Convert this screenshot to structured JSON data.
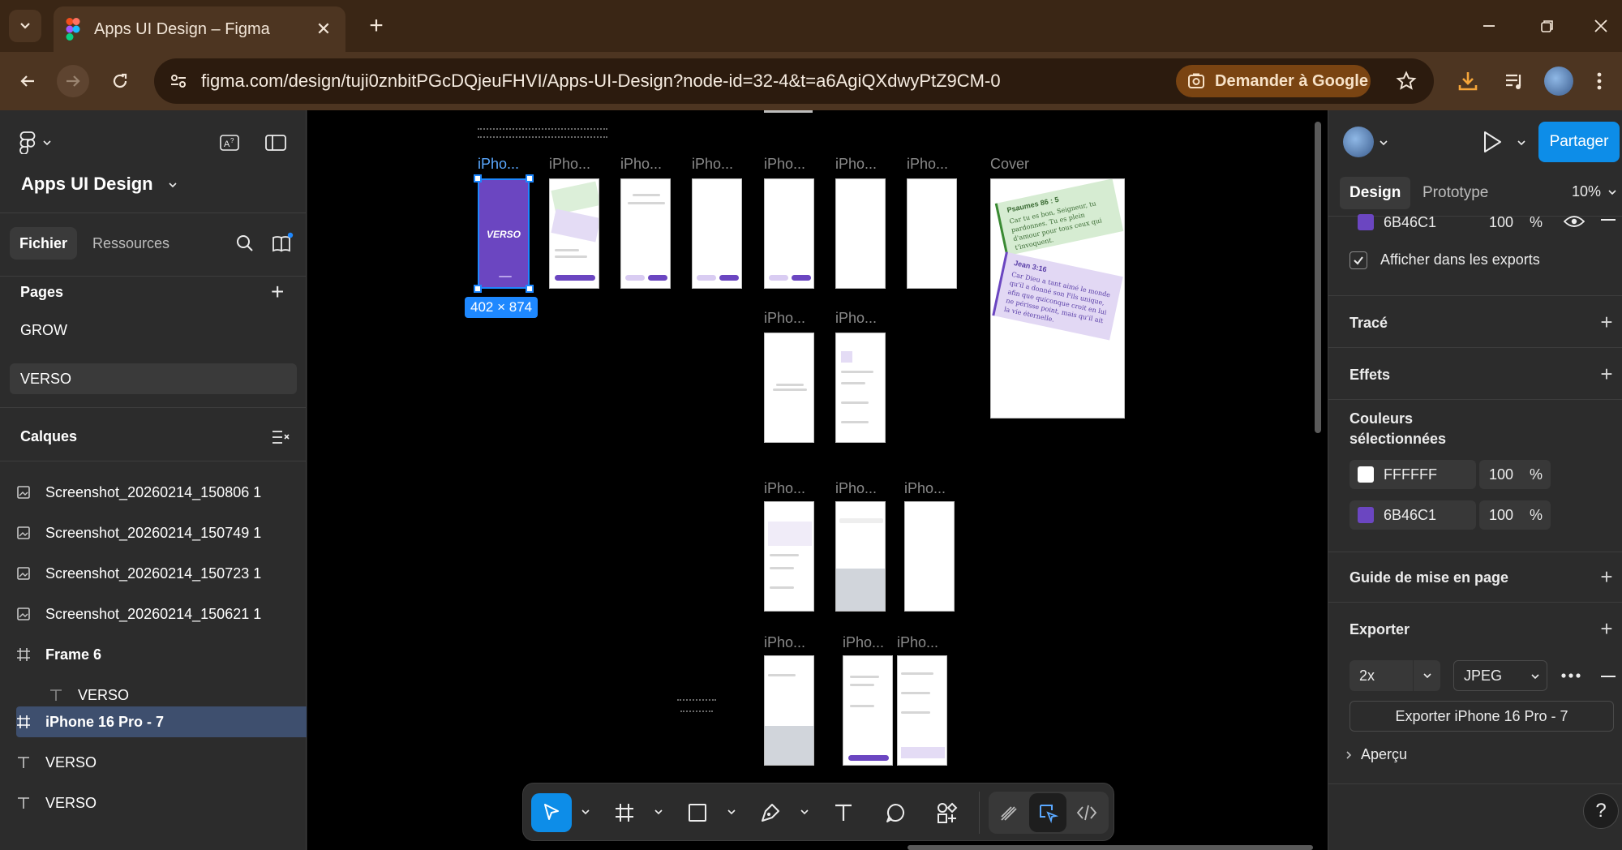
{
  "browser": {
    "tab_title": "Apps UI Design – Figma",
    "tab_close": "✕",
    "new_tab": "+",
    "url": "figma.com/design/tuji0znbitPGcDQjeuFHVI/Apps-UI-Design?node-id=32-4&t=a6AgiQXdwyPtZ9CM-0",
    "gemini_label": "Demander à Google",
    "accent": "#7a4412"
  },
  "left_panel": {
    "file_title": "Apps UI Design",
    "tabs": [
      {
        "label": "Fichier"
      },
      {
        "label": "Ressources"
      }
    ],
    "pages_heading": "Pages",
    "pages": [
      {
        "label": "GROW"
      },
      {
        "label": "VERSO"
      }
    ],
    "layers_heading": "Calques",
    "layers": [
      {
        "label": "Screenshot_20260214_150806 1",
        "icon": "image-icon"
      },
      {
        "label": "Screenshot_20260214_150749 1",
        "icon": "image-icon"
      },
      {
        "label": "Screenshot_20260214_150723 1",
        "icon": "image-icon"
      },
      {
        "label": "Screenshot_20260214_150621 1",
        "icon": "image-icon"
      },
      {
        "label": "Frame 6",
        "icon": "frame-icon"
      },
      {
        "label": "VERSO",
        "icon": "text-icon"
      },
      {
        "label": "iPhone 16 Pro - 7",
        "icon": "frame-icon"
      },
      {
        "label": "VERSO",
        "icon": "text-icon"
      },
      {
        "label": "VERSO",
        "icon": "text-icon"
      }
    ]
  },
  "canvas": {
    "frame_labels": [
      "iPho...",
      "iPho...",
      "iPho...",
      "iPho...",
      "iPho...",
      "iPho...",
      "iPho...",
      "Cover",
      "iPho...",
      "iPho...",
      "iPho...",
      "iPho...",
      "iPho...",
      "iPho...",
      "iPho...",
      "iPho..."
    ],
    "verso_text": "VERSO",
    "selection_size": "402 × 874",
    "cover_cards": [
      {
        "ref": "Psaumes 86 : 5",
        "text": "Car tu es bon, Seigneur, tu pardonnes. Tu es plein d'amour pour tous ceux qui t'invoquent."
      },
      {
        "ref": "Jean 3:16",
        "text": "Car Dieu a tant aimé le monde qu'il a donné son Fils unique, afin que quiconque croit en lui ne périsse point, mais qu'il ait la vie éternelle."
      }
    ],
    "selection_color": "#1e88ff"
  },
  "right_panel": {
    "share_label": "Partager",
    "tabs": [
      {
        "label": "Design"
      },
      {
        "label": "Prototype"
      }
    ],
    "zoom": "10%",
    "fill": {
      "hex": "6B46C1",
      "opacity": "100",
      "unit": "%"
    },
    "show_in_exports": "Afficher dans les exports",
    "sections": {
      "stroke": "Tracé",
      "effects": "Effets",
      "selected_colors": "Couleurs sélectionnées",
      "layout_guide": "Guide de mise en page",
      "export": "Exporter"
    },
    "selected_colors": [
      {
        "hex": "FFFFFF",
        "opacity": "100",
        "unit": "%",
        "swatch": "#FFFFFF"
      },
      {
        "hex": "6B46C1",
        "opacity": "100",
        "unit": "%",
        "swatch": "#6B46C1"
      }
    ],
    "export": {
      "scale": "2x",
      "format": "JPEG",
      "button_label": "Exporter iPhone 16 Pro - 7",
      "preview_label": "Aperçu"
    },
    "help": "?"
  }
}
